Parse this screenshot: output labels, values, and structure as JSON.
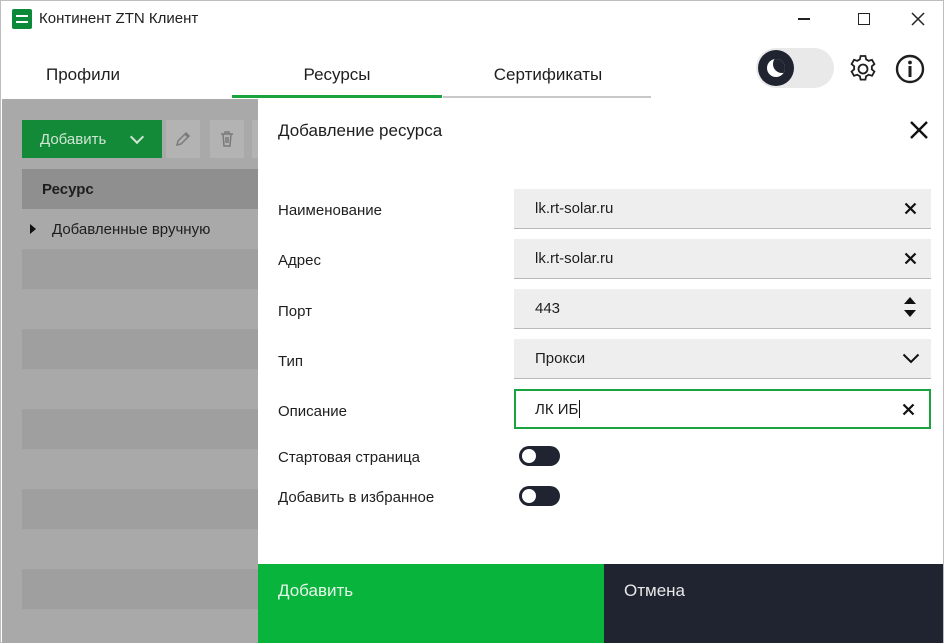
{
  "window": {
    "title": "Континент ZTN Клиент"
  },
  "tabs": [
    {
      "label": "Профили"
    },
    {
      "label": "Ресурсы"
    },
    {
      "label": "Сертификаты"
    }
  ],
  "left_panel": {
    "add_label": "Добавить",
    "column_header": "Ресурс",
    "group_label": "Добавленные вручную"
  },
  "dialog": {
    "title": "Добавление ресурса",
    "fields": {
      "name": {
        "label": "Наименование",
        "value": "lk.rt-solar.ru"
      },
      "address": {
        "label": "Адрес",
        "value": "lk.rt-solar.ru"
      },
      "port": {
        "label": "Порт",
        "value": "443"
      },
      "type": {
        "label": "Тип",
        "value": "Прокси"
      },
      "description": {
        "label": "Описание",
        "value": "ЛК ИБ"
      }
    },
    "toggles": {
      "start_page": {
        "label": "Стартовая страница",
        "on": false
      },
      "favorite": {
        "label": "Добавить в избранное",
        "on": false
      }
    },
    "ok_label": "Добавить",
    "cancel_label": "Отмена"
  },
  "colors": {
    "accent": "#1aa33f",
    "ok_button": "#09b43c",
    "cancel_button": "#1f2430"
  }
}
